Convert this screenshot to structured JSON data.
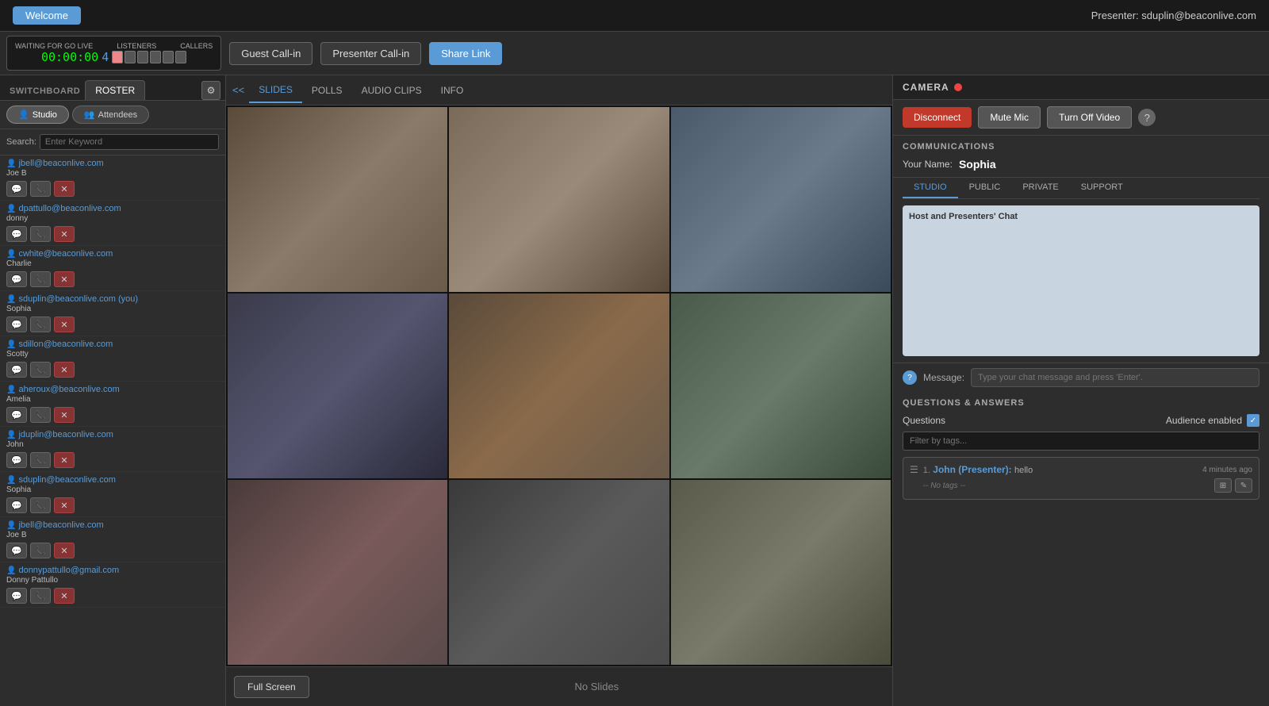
{
  "topbar": {
    "welcome_label": "Welcome",
    "presenter_info": "Presenter: sduplin@beaconlive.com"
  },
  "secondbar": {
    "waiting_label": "WAITING FOR GO LIVE",
    "listeners_label": "LISTENERS",
    "callers_label": "CALLERS",
    "timer": "00:00:00",
    "listener_count": "4",
    "guest_callin": "Guest Call-in",
    "presenter_callin": "Presenter Call-in",
    "share_link": "Share Link"
  },
  "left_panel": {
    "switchboard_label": "SWITCHBOARD",
    "roster_label": "ROSTER",
    "studio_label": "Studio",
    "attendees_label": "Attendees",
    "search_label": "Search:",
    "search_placeholder": "Enter Keyword",
    "roster_items": [
      {
        "email": "jbell@beaconlive.com",
        "name": "Joe B"
      },
      {
        "email": "dpattullo@beaconlive.com",
        "name": "donny"
      },
      {
        "email": "cwhite@beaconlive.com",
        "name": "Charlie"
      },
      {
        "email": "sduplin@beaconlive.com (you)",
        "name": "Sophia"
      },
      {
        "email": "sdillon@beaconlive.com",
        "name": "Scotty"
      },
      {
        "email": "aheroux@beaconlive.com",
        "name": "Amelia"
      },
      {
        "email": "jduplin@beaconlive.com",
        "name": "John"
      },
      {
        "email": "sduplin@beaconlive.com",
        "name": "Sophia"
      },
      {
        "email": "jbell@beaconlive.com",
        "name": "Joe B"
      },
      {
        "email": "donnypattullo@gmail.com",
        "name": "Donny Pattullo"
      }
    ]
  },
  "center_panel": {
    "back_label": "<<",
    "tabs": [
      "SLIDES",
      "POLLS",
      "AUDIO CLIPS",
      "INFO"
    ],
    "active_tab": "SLIDES",
    "no_slides": "No Slides",
    "fullscreen": "Full Screen"
  },
  "right_panel": {
    "camera_label": "CAMERA",
    "disconnect_label": "Disconnect",
    "mute_mic_label": "Mute Mic",
    "turn_off_video_label": "Turn Off Video",
    "communications_label": "COMMUNICATIONS",
    "your_name_label": "Your Name:",
    "your_name_value": "Sophia",
    "chat_tabs": [
      "STUDIO",
      "PUBLIC",
      "PRIVATE",
      "SUPPORT"
    ],
    "active_chat_tab": "STUDIO",
    "chat_header": "Host and Presenters' Chat",
    "message_label": "Message:",
    "message_placeholder": "Type your chat message and press 'Enter'.",
    "qa_label": "QUESTIONS & ANSWERS",
    "questions_label": "Questions",
    "audience_enabled_label": "Audience enabled",
    "filter_placeholder": "Filter by tags...",
    "qa_items": [
      {
        "number": "1.",
        "author": "John (Presenter):",
        "message": "hello",
        "time": "4 minutes ago",
        "tags": "-- No tags --"
      }
    ]
  }
}
